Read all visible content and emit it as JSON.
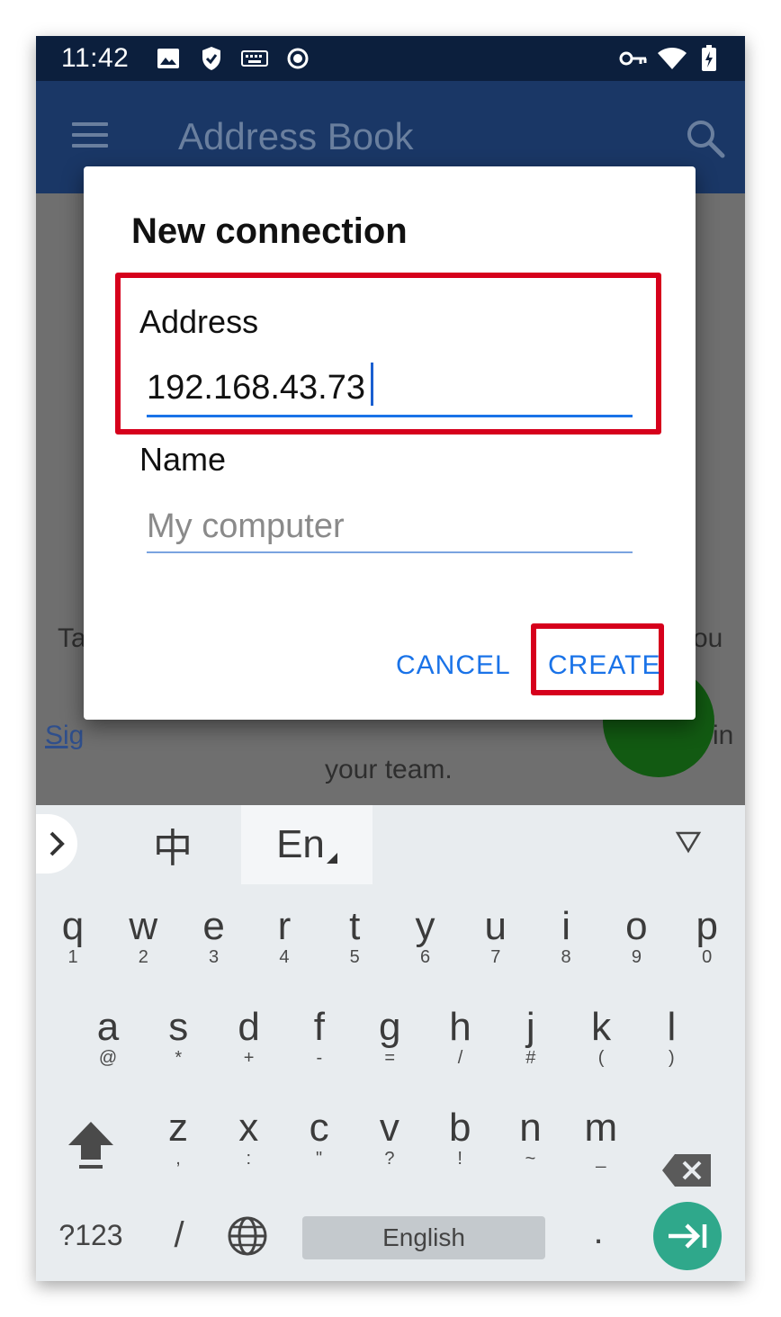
{
  "status_bar": {
    "time": "11:42",
    "left_icons": [
      "image-icon",
      "shield-icon",
      "keyboard-icon",
      "record-icon"
    ],
    "right_icons": [
      "vpn-key-icon",
      "wifi-icon",
      "battery-charging-icon"
    ]
  },
  "app_bar": {
    "title": "Address Book",
    "menu_icon": "hamburger-menu-icon",
    "search_icon": "search-icon"
  },
  "background": {
    "fragment_left_1": "Ta",
    "fragment_right_1": "ou",
    "link_fragment": "Sig",
    "fragment_right_2": "in",
    "team_text": "your team."
  },
  "dialog": {
    "title": "New connection",
    "address_label": "Address",
    "address_value": "192.168.43.73",
    "name_label": "Name",
    "name_placeholder": "My computer",
    "cancel_label": "CANCEL",
    "create_label": "CREATE",
    "highlight_color": "#d6001c",
    "accent_color": "#1a73e8"
  },
  "keyboard": {
    "toolbar": {
      "expand_icon": "chevron-right-icon",
      "tab_chinese": "中",
      "tab_english": "En",
      "collapse_icon": "triangle-down-icon"
    },
    "row1": [
      {
        "key": "q",
        "sub": "1"
      },
      {
        "key": "w",
        "sub": "2"
      },
      {
        "key": "e",
        "sub": "3"
      },
      {
        "key": "r",
        "sub": "4"
      },
      {
        "key": "t",
        "sub": "5"
      },
      {
        "key": "y",
        "sub": "6"
      },
      {
        "key": "u",
        "sub": "7"
      },
      {
        "key": "i",
        "sub": "8"
      },
      {
        "key": "o",
        "sub": "9"
      },
      {
        "key": "p",
        "sub": "0"
      }
    ],
    "row2": [
      {
        "key": "a",
        "sub": "@"
      },
      {
        "key": "s",
        "sub": "*"
      },
      {
        "key": "d",
        "sub": "+"
      },
      {
        "key": "f",
        "sub": "-"
      },
      {
        "key": "g",
        "sub": "="
      },
      {
        "key": "h",
        "sub": "/"
      },
      {
        "key": "j",
        "sub": "#"
      },
      {
        "key": "k",
        "sub": "("
      },
      {
        "key": "l",
        "sub": ")"
      }
    ],
    "row3": [
      {
        "key": "z",
        "sub": ","
      },
      {
        "key": "x",
        "sub": ":"
      },
      {
        "key": "c",
        "sub": "\""
      },
      {
        "key": "v",
        "sub": "?"
      },
      {
        "key": "b",
        "sub": "!"
      },
      {
        "key": "n",
        "sub": "~"
      },
      {
        "key": "m",
        "sub": "_"
      }
    ],
    "bottom": {
      "symbols": "?123",
      "slash": "/",
      "globe_icon": "globe-icon",
      "space_label": "English",
      "period": ".",
      "enter_icon": "enter-arrow-icon",
      "shift_icon": "shift-icon",
      "backspace_icon": "backspace-icon"
    }
  }
}
